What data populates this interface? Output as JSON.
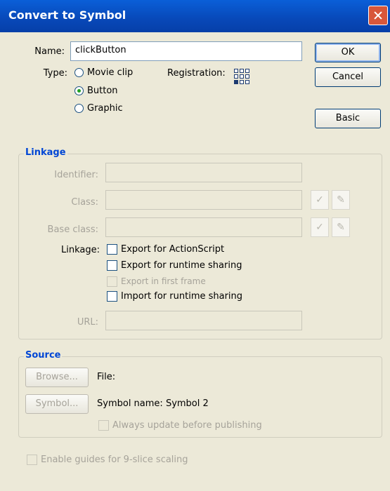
{
  "window": {
    "title": "Convert to Symbol"
  },
  "name_field": {
    "label": "Name:",
    "value": "clickButton"
  },
  "type": {
    "label": "Type:",
    "options": [
      {
        "label": "Movie clip",
        "selected": false
      },
      {
        "label": "Button",
        "selected": true
      },
      {
        "label": "Graphic",
        "selected": false
      }
    ]
  },
  "registration": {
    "label": "Registration:"
  },
  "buttons": {
    "ok": "OK",
    "cancel": "Cancel",
    "basic": "Basic"
  },
  "linkage": {
    "legend": "Linkage",
    "identifier_label": "Identifier:",
    "class_label": "Class:",
    "base_class_label": "Base class:",
    "linkage_label": "Linkage:",
    "checkboxes": [
      {
        "label": "Export for ActionScript",
        "enabled": true
      },
      {
        "label": "Export for runtime sharing",
        "enabled": true
      },
      {
        "label": "Export in first frame",
        "enabled": false
      },
      {
        "label": "Import for runtime sharing",
        "enabled": true
      }
    ],
    "url_label": "URL:"
  },
  "source": {
    "legend": "Source",
    "browse_button": "Browse...",
    "file_label": "File:",
    "symbol_button": "Symbol...",
    "symbol_name": "Symbol name: Symbol 2",
    "always_update": "Always update before publishing"
  },
  "nine_slice": {
    "label": "Enable guides for 9-slice scaling"
  }
}
